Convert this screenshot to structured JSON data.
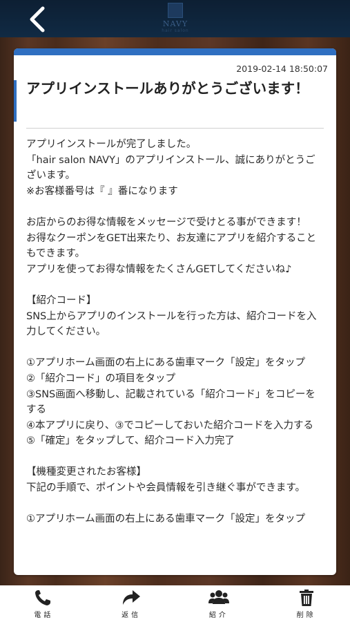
{
  "header": {
    "back_icon": "chevron-left-icon",
    "logo_text": "NAVY",
    "logo_sub": "hair salon"
  },
  "message": {
    "timestamp": "2019-02-14 18:50:07",
    "title": "アプリインストールありがとうございます！",
    "body": "アプリインストールが完了しました。\n「hair salon NAVY」のアプリインストール、誠にありがとうございます。\n※お客様番号は『 』番になります\n\nお店からのお得な情報をメッセージで受けとる事ができます！\nお得なクーポンをGET出来たり、お友達にアプリを紹介することもできます。\nアプリを使ってお得な情報をたくさんGETしてくださいね♪\n\n【紹介コード】\nSNS上からアプリのインストールを行った方は、紹介コードを入力してください。\n\n①アプリホーム画面の右上にある歯車マーク「設定」をタップ\n②「紹介コード」の項目をタップ\n③SNS画面へ移動し、記載されている「紹介コード」をコピーをする\n④本アプリに戻り、③でコピーしておいた紹介コードを入力する\n⑤「確定」をタップして、紹介コード入力完了\n\n【機種変更されたお客様】\n下記の手順で、ポイントや会員情報を引き継ぐ事ができます。\n\n①アプリホーム画面の右上にある歯車マーク「設定」をタップ"
  },
  "tabs": [
    {
      "label": "電話",
      "icon": "phone-icon"
    },
    {
      "label": "返信",
      "icon": "reply-icon"
    },
    {
      "label": "紹介",
      "icon": "users-icon"
    },
    {
      "label": "削除",
      "icon": "trash-icon"
    }
  ],
  "colors": {
    "accent": "#2f6fc1",
    "header_bg": "#0d1f33"
  }
}
